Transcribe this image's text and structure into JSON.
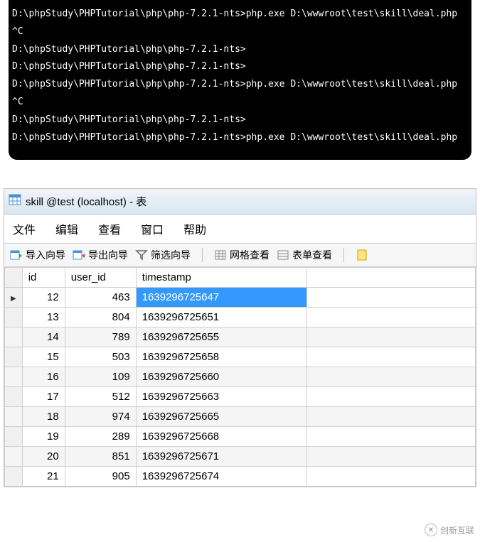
{
  "terminal": {
    "lines": [
      "D:\\phpStudy\\PHPTutorial\\php\\php-7.2.1-nts>php.exe D:\\wwwroot\\test\\skill\\deal.php",
      "^C",
      "D:\\phpStudy\\PHPTutorial\\php\\php-7.2.1-nts>",
      "D:\\phpStudy\\PHPTutorial\\php\\php-7.2.1-nts>",
      "D:\\phpStudy\\PHPTutorial\\php\\php-7.2.1-nts>php.exe D:\\wwwroot\\test\\skill\\deal.php",
      "^C",
      "D:\\phpStudy\\PHPTutorial\\php\\php-7.2.1-nts>",
      "D:\\phpStudy\\PHPTutorial\\php\\php-7.2.1-nts>php.exe D:\\wwwroot\\test\\skill\\deal.php"
    ]
  },
  "window": {
    "title": "skill @test (localhost) - 表"
  },
  "menu": {
    "file": "文件",
    "edit": "编辑",
    "view": "查看",
    "window": "窗口",
    "help": "帮助"
  },
  "toolbar": {
    "import": "导入向导",
    "export": "导出向导",
    "filter": "筛选向导",
    "grid_view": "网格查看",
    "form_view": "表单查看"
  },
  "table": {
    "headers": {
      "id": "id",
      "user_id": "user_id",
      "timestamp": "timestamp"
    },
    "rows": [
      {
        "id": "12",
        "user_id": "463",
        "timestamp": "1639296725647",
        "selected": true
      },
      {
        "id": "13",
        "user_id": "804",
        "timestamp": "1639296725651"
      },
      {
        "id": "14",
        "user_id": "789",
        "timestamp": "1639296725655"
      },
      {
        "id": "15",
        "user_id": "503",
        "timestamp": "1639296725658"
      },
      {
        "id": "16",
        "user_id": "109",
        "timestamp": "1639296725660"
      },
      {
        "id": "17",
        "user_id": "512",
        "timestamp": "1639296725663"
      },
      {
        "id": "18",
        "user_id": "974",
        "timestamp": "1639296725665"
      },
      {
        "id": "19",
        "user_id": "289",
        "timestamp": "1639296725668"
      },
      {
        "id": "20",
        "user_id": "851",
        "timestamp": "1639296725671"
      },
      {
        "id": "21",
        "user_id": "905",
        "timestamp": "1639296725674"
      }
    ]
  },
  "watermark": {
    "text": "创新互联"
  }
}
